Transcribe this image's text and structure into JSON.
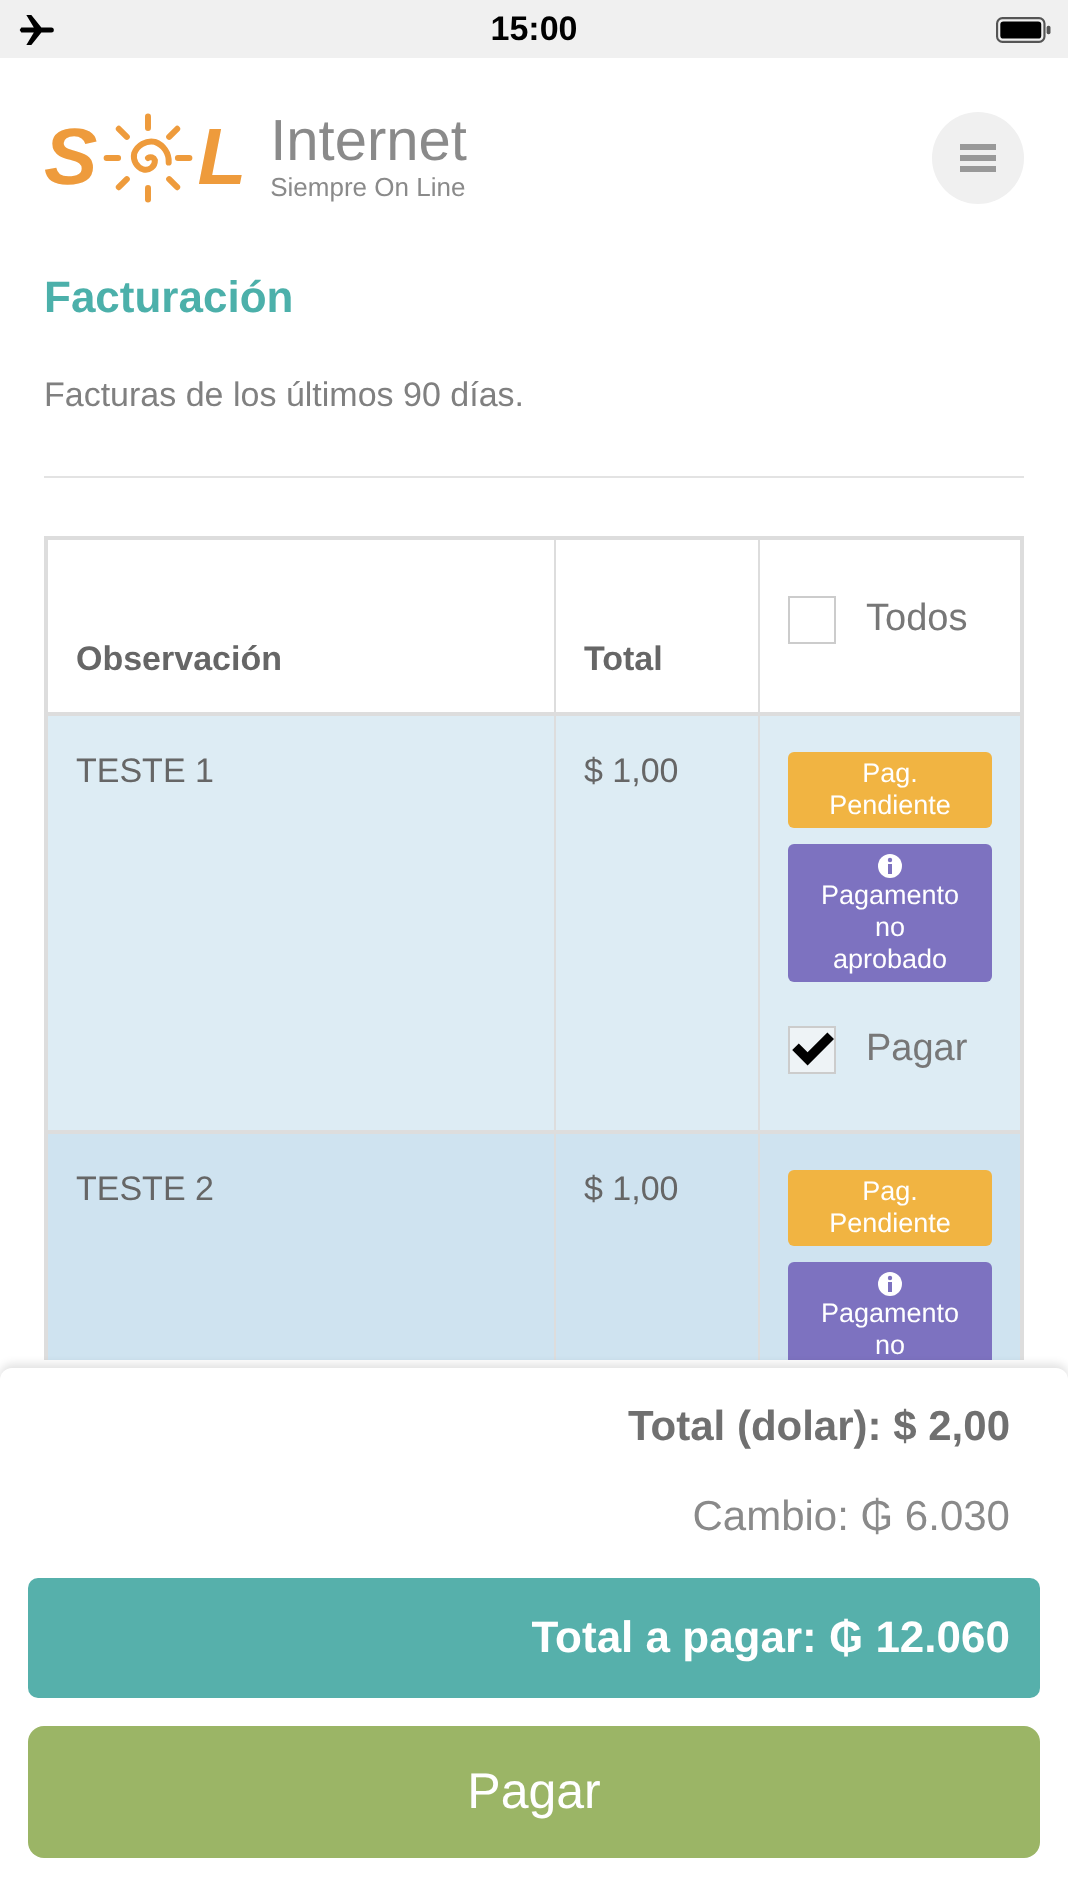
{
  "status_bar": {
    "time": "15:00",
    "airplane_mode": true
  },
  "header": {
    "logo_left": "S",
    "logo_right": "L",
    "brand": "Internet",
    "tagline": "Siempre On Line"
  },
  "page": {
    "title": "Facturación",
    "description": "Facturas de los últimos 90 días."
  },
  "table": {
    "columns": [
      "Observación",
      "Total"
    ],
    "select_all": {
      "label": "Todos",
      "checked": false
    },
    "rows": [
      {
        "observation": "TESTE 1",
        "total": "$ 1,00",
        "badges": [
          {
            "kind": "pending",
            "text": "Pag. Pendiente"
          },
          {
            "kind": "info",
            "text": "Pagamento no aprobado"
          }
        ],
        "pay": {
          "label": "Pagar",
          "checked": true
        }
      },
      {
        "observation": "TESTE 2",
        "total": "$ 1,00",
        "badges": [
          {
            "kind": "pending",
            "text": "Pag. Pendiente"
          },
          {
            "kind": "info",
            "text": "Pagamento no"
          }
        ]
      }
    ]
  },
  "footer": {
    "total_dollar": "Total (dolar): $ 2,00",
    "exchange": "Cambio: ₲ 6.030",
    "total_to_pay": "Total a pagar: ₲ 12.060",
    "pay_button": "Pagar"
  }
}
